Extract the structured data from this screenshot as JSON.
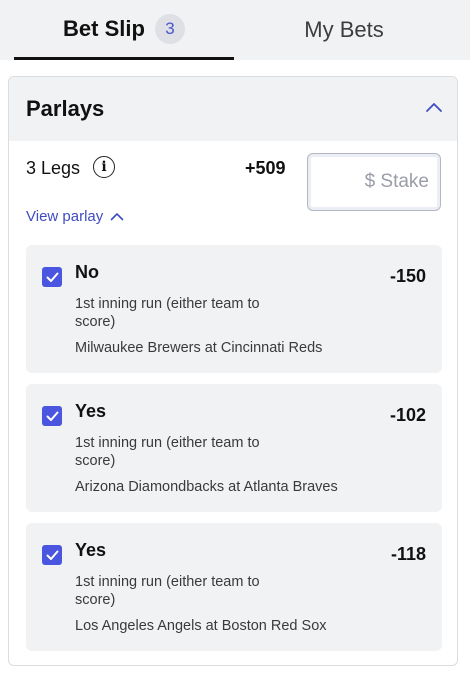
{
  "tabs": {
    "bet_slip": {
      "label": "Bet Slip",
      "count": "3"
    },
    "my_bets": {
      "label": "My Bets"
    }
  },
  "parlay": {
    "title": "Parlays",
    "legs_label": "3 Legs",
    "info_icon": "info-icon",
    "odds": "+509",
    "stake_placeholder": "$ Stake",
    "stake_value": "",
    "view_parlay_label": "View parlay"
  },
  "legs": [
    {
      "checked": true,
      "selection": "No",
      "odds": "-150",
      "market": "1st inning run (either team to score)",
      "event": "Milwaukee Brewers at Cincinnati Reds"
    },
    {
      "checked": true,
      "selection": "Yes",
      "odds": "-102",
      "market": "1st inning run (either team to score)",
      "event": "Arizona Diamondbacks at Atlanta Braves"
    },
    {
      "checked": true,
      "selection": "Yes",
      "odds": "-118",
      "market": "1st inning run (either team to score)",
      "event": "Los Angeles Angels at Boston Red Sox"
    }
  ],
  "colors": {
    "accent": "#4a55e0",
    "link": "#3e4cc2",
    "panel_bg": "#f1f2f4"
  }
}
